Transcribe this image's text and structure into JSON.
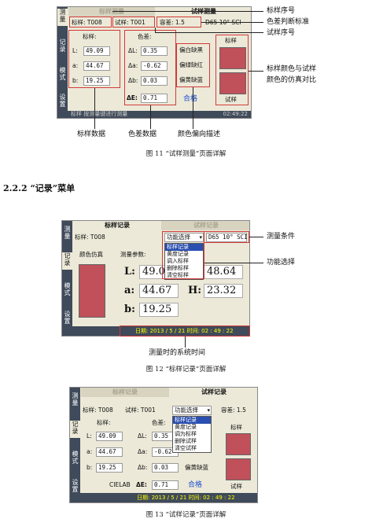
{
  "fig11": {
    "side_tabs": [
      "测量",
      "记录",
      "模式",
      "设置"
    ],
    "tab_inactive": "标样测量",
    "tab_active": "试样测量",
    "std_label": "标样: T008",
    "sample_label": "试样: T001",
    "tol_label": "容差: 1.5",
    "illum_label": "D65 10° SCI",
    "std_heading": "标样:",
    "std_rows": [
      {
        "k": "L:",
        "v": "49.09"
      },
      {
        "k": "a:",
        "v": "44.67"
      },
      {
        "k": "b:",
        "v": "19.25"
      }
    ],
    "diff_heading": "色差:",
    "diff_rows": [
      {
        "k": "ΔL:",
        "v": "0.35"
      },
      {
        "k": "Δa:",
        "v": "-0.62"
      },
      {
        "k": "Δb:",
        "v": "0.03"
      }
    ],
    "de_key": "ΔE:",
    "de_val": "0.71",
    "desc": [
      "偏白缺黑",
      "偏绿缺红",
      "偏黄缺蓝"
    ],
    "pass": "合格",
    "swatch_std": "标样",
    "swatch_smp": "试样",
    "status_left": "标样  按测量键进行测量",
    "status_time": "02:49:22",
    "ann_right": [
      "标样序号",
      "色差判断标准",
      "试样序号",
      "标样颜色与试样",
      "颜色的仿真对比"
    ],
    "ann_bottom": [
      "标样数据",
      "色差数据",
      "颜色偏向描述"
    ],
    "caption": "图 11  “试样测量”页面详解"
  },
  "section": "2.2.2  “记录”菜单",
  "fig12": {
    "tab_active": "标样记录",
    "tab_inactive": "试样记录",
    "std_label": "标样: T008",
    "func_select": "功能选择",
    "illum_label": "D65 10° SCI",
    "sim_label": "颜色仿真",
    "param_label": "测量参数:",
    "menu": [
      "标样记录",
      "黄度记录",
      "调入标样",
      "删除标样",
      "清空标样"
    ],
    "L_key": "L:",
    "L_val": "49.09",
    "C_val": "48.64",
    "a_key": "a:",
    "a_val": "44.67",
    "H_key": "H:",
    "H_val": "23.32",
    "b_key": "b:",
    "b_val": "19.25",
    "status": "日期: 2013 / 5 / 21  时间: 02 : 49 : 22",
    "ann_right": [
      "测量条件",
      "功能选择"
    ],
    "ann_bottom": "测量时的系统时间",
    "caption": "图 12  “标样记录”页面详解"
  },
  "fig13": {
    "tab_inactive": "标样记录",
    "tab_active": "试样记录",
    "std_label": "标样: T008",
    "sample_label": "试样: T001",
    "func_select": "功能选择",
    "tol_label": "容差: 1.5",
    "std_heading": "标样:",
    "diff_heading": "色差:",
    "std_rows": [
      {
        "k": "L:",
        "v": "49.09"
      },
      {
        "k": "a:",
        "v": "44.67"
      },
      {
        "k": "b:",
        "v": "19.25"
      }
    ],
    "diff_rows": [
      {
        "k": "ΔL:",
        "v": "0.35"
      },
      {
        "k": "Δa:",
        "v": "-0.62"
      },
      {
        "k": "Δb:",
        "v": "0.03"
      }
    ],
    "menu": [
      "标样记录",
      "黄度记录",
      "调为标样",
      "删除试样",
      "清空试样"
    ],
    "desc": "偏黄缺蓝",
    "cielab": "CIELAB",
    "de_key": "ΔE:",
    "de_val": "0.71",
    "pass": "合格",
    "swatch_std": "标样",
    "swatch_smp": "试样",
    "status": "日期: 2013 / 5 / 21  时间: 02 : 49 : 22",
    "caption": "图 13  “试样记录”页面详解"
  }
}
